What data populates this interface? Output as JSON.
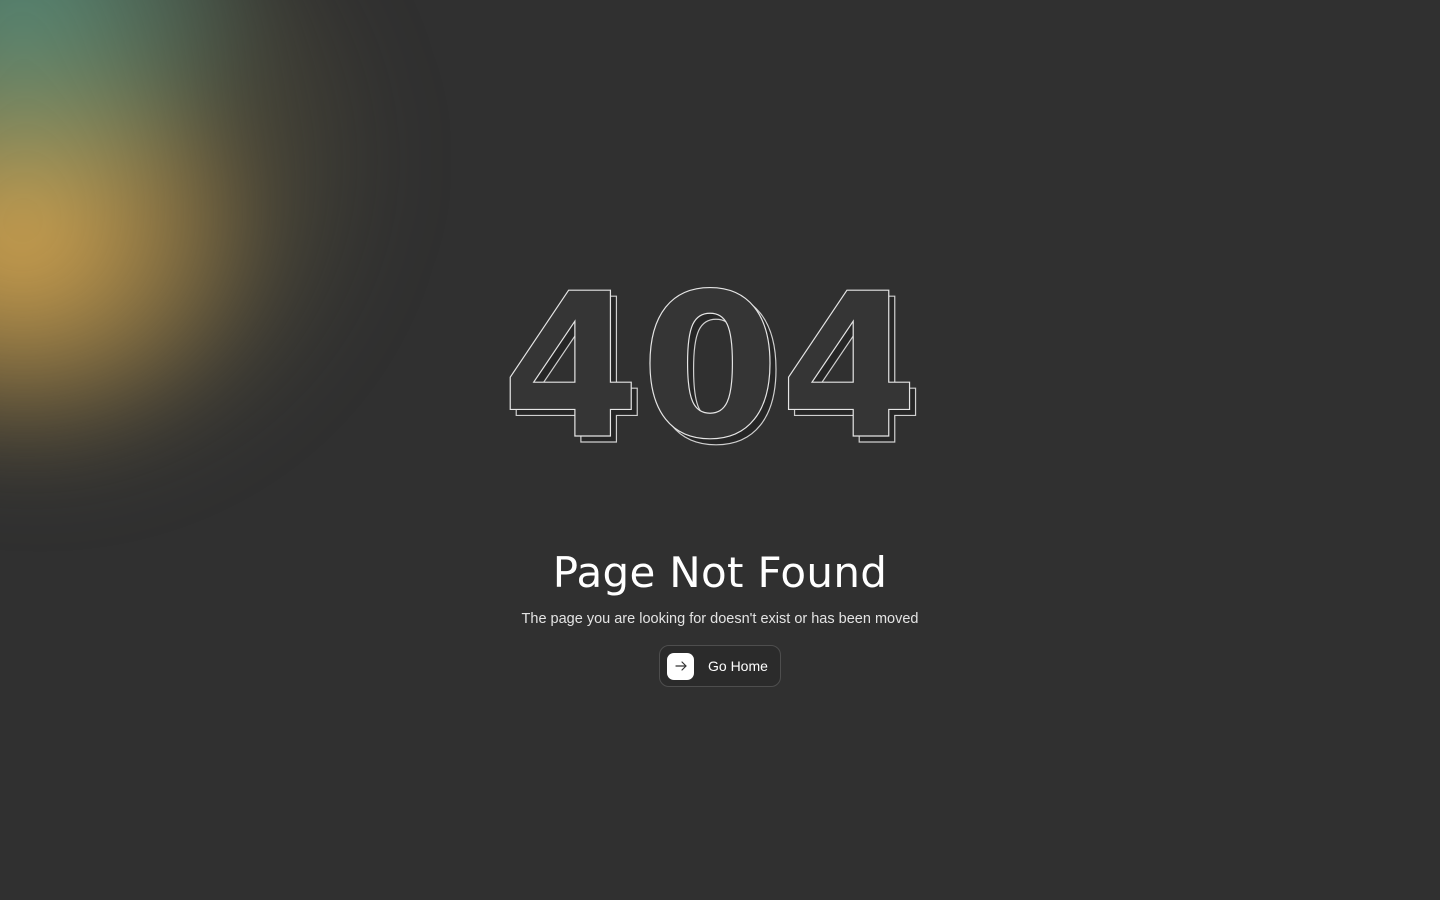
{
  "hero": {
    "code": "404",
    "title": "Page Not Found",
    "message": "The page you are looking for doesn't exist or has been moved"
  },
  "actions": {
    "home_label": "Go Home",
    "home_icon": "arrow-right-icon"
  },
  "colors": {
    "background": "#303030",
    "text": "#ffffff",
    "glow_gold": "#dcaa50",
    "glow_teal": "#5aa08c"
  }
}
